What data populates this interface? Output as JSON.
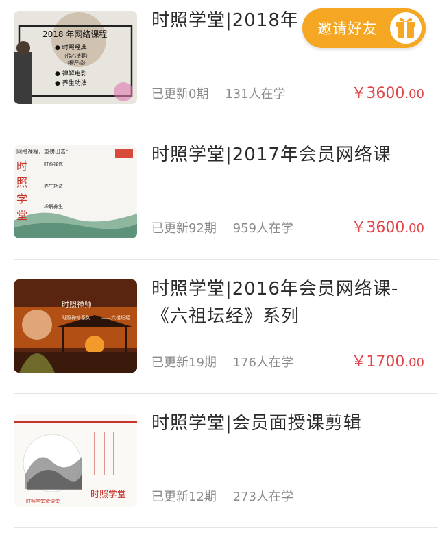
{
  "courses": [
    {
      "title": "时照学堂|2018年",
      "updated": "已更新0期",
      "learners": "131人在学",
      "price_symbol": "￥",
      "price_int": "3600",
      "price_dec": ".00",
      "thumb_lines": [
        "2018 年网络课程",
        "● 时照经典",
        "（传心法要）",
        "（楞严经）",
        "● 禅解电影",
        "● 养生功法"
      ]
    },
    {
      "title": "时照学堂|2017年会员网络课",
      "updated": "已更新92期",
      "learners": "959人在学",
      "price_symbol": "￥",
      "price_int": "3600",
      "price_dec": ".00",
      "thumb_lines": [
        "网络课程，重磅出击：",
        "时照禅修",
        "养生功法",
        "禅解养生",
        "时",
        "照",
        "学",
        "堂"
      ]
    },
    {
      "title": "时照学堂|2016年会员网络课-《六祖坛经》系列",
      "updated": "已更新19期",
      "learners": "176人在学",
      "price_symbol": "￥",
      "price_int": "1700",
      "price_dec": ".00",
      "thumb_lines": [
        "时照禅师",
        "时照禅修系列",
        "——六祖坛经"
      ]
    },
    {
      "title": "时照学堂|会员面授课剪辑",
      "updated": "已更新12期",
      "learners": "273人在学",
      "price_symbol": "",
      "price_int": "",
      "price_dec": "",
      "thumb_lines": [
        "时照学堂",
        "时照学堂微课堂"
      ]
    }
  ],
  "invite_button": {
    "label": "邀请好友",
    "icon": "gift-icon"
  },
  "colors": {
    "price": "#e0454a",
    "invite_bg": "#f5a623",
    "meta": "#8a8a8a",
    "title": "#2b2b2b",
    "divider": "#e4e4e4"
  }
}
